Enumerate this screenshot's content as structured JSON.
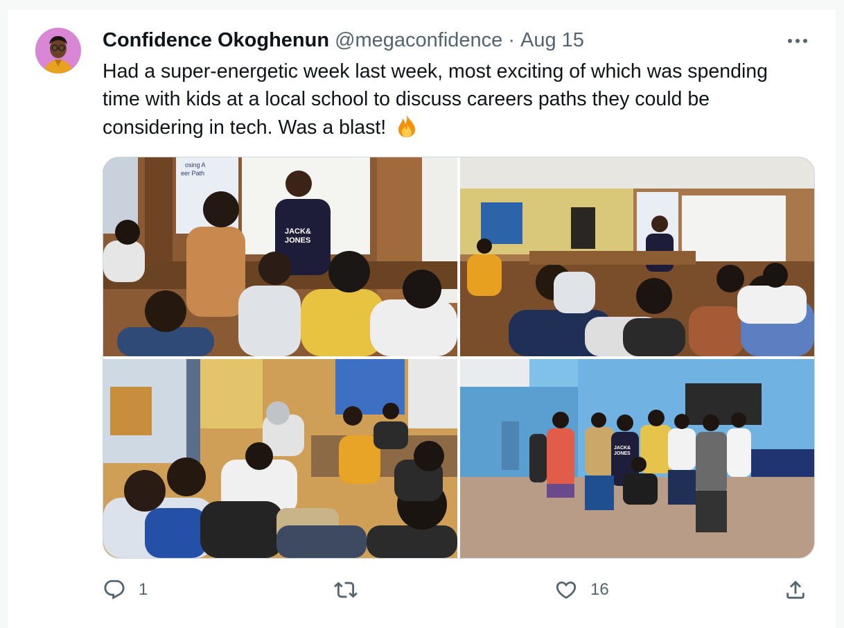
{
  "tweet": {
    "author": {
      "display_name": "Confidence Okoghenun",
      "handle": "@megaconfidence",
      "avatar_bg": "#d987d4"
    },
    "separator": "·",
    "date": "Aug 15",
    "text": "Had a super-energetic week last week, most exciting of which was spending time with kids at a local school to discuss careers paths they could be considering in tech. Was a blast!",
    "emoji_icon": "fire-icon",
    "media": [
      {
        "name": "classroom-photo-1",
        "banner_text": "Choosing A Career Path in Tech",
        "shirt_text": "JACK& JONES"
      },
      {
        "name": "classroom-photo-2"
      },
      {
        "name": "classroom-photo-3"
      },
      {
        "name": "group-photo-outdoor",
        "shirt_text": "JACK& JONES"
      }
    ],
    "actions": {
      "reply": {
        "icon": "reply-icon",
        "count": "1"
      },
      "retweet": {
        "icon": "retweet-icon",
        "count": ""
      },
      "like": {
        "icon": "heart-icon",
        "count": "16"
      },
      "share": {
        "icon": "share-icon"
      }
    }
  },
  "colors": {
    "text_primary": "#0f1419",
    "text_secondary": "#536471",
    "border": "#cfd9de"
  }
}
